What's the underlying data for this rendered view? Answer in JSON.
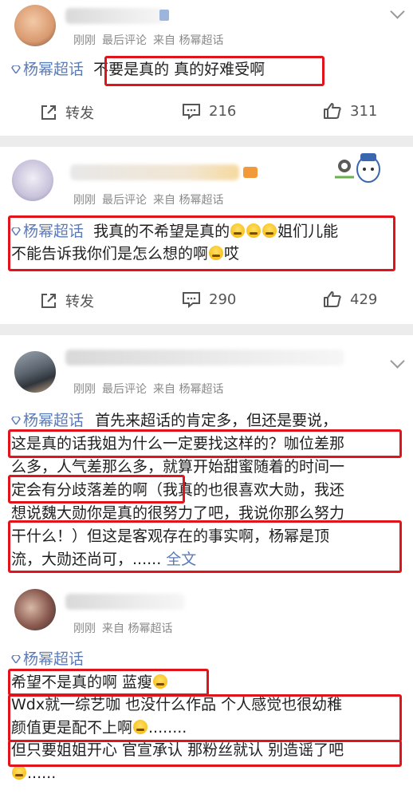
{
  "colors": {
    "accent": "#5b7bb8",
    "highlight_box": "#e0141a",
    "meta": "#8a8a8a"
  },
  "posts": [
    {
      "meta": {
        "time": "刚刚",
        "sort": "最后评论",
        "source": "来自 杨幂超话"
      },
      "topic": "杨幂超话",
      "text": "不要是真的 真的好难受啊",
      "actions": {
        "repost": "转发",
        "comments": "216",
        "likes": "311"
      }
    },
    {
      "meta": {
        "time": "刚刚",
        "sort": "最后评论",
        "source": "来自 杨幂超话"
      },
      "topic": "杨幂超话",
      "text_a": "我真的不希望是真的",
      "text_b": "姐们儿能",
      "text_c": "不能告诉我你们是怎么想的啊",
      "text_d": "哎",
      "actions": {
        "repost": "转发",
        "comments": "290",
        "likes": "429"
      }
    },
    {
      "meta": {
        "time": "刚刚",
        "sort": "最后评论",
        "source": "来自 杨幂超话"
      },
      "topic": "杨幂超话",
      "line1": "首先来超话的肯定多，但还是要说，",
      "line2": "这是真的话我姐为什么一定要找这样的？咖位差那",
      "line3": "么多，人气差那么多，就算开始甜蜜随着的时间一",
      "line4": "定会有分歧落差的啊（我真的也很喜欢大勋，我还",
      "line5": "想说魏大勋你是真的很努力了吧，我说你那么努力",
      "line6": "干什么！）但这是客观存在的事实啊，杨幂是顶",
      "line7": "流，大勋还尚可，......",
      "more": "全文"
    },
    {
      "meta": {
        "time": "刚刚",
        "source": "来自 杨幂超话"
      },
      "topic": "杨幂超话",
      "line1": "希望不是真的啊 蓝瘦",
      "line2": "Wdx就一综艺咖 也没什么作品 个人感觉也很幼稚",
      "line3": "颜值更是配不上啊",
      "line3_tail": "........",
      "line4": "但只要姐姐开心 官宣承认 那粉丝就认 别造谣了吧",
      "line5_tail": "......"
    }
  ]
}
